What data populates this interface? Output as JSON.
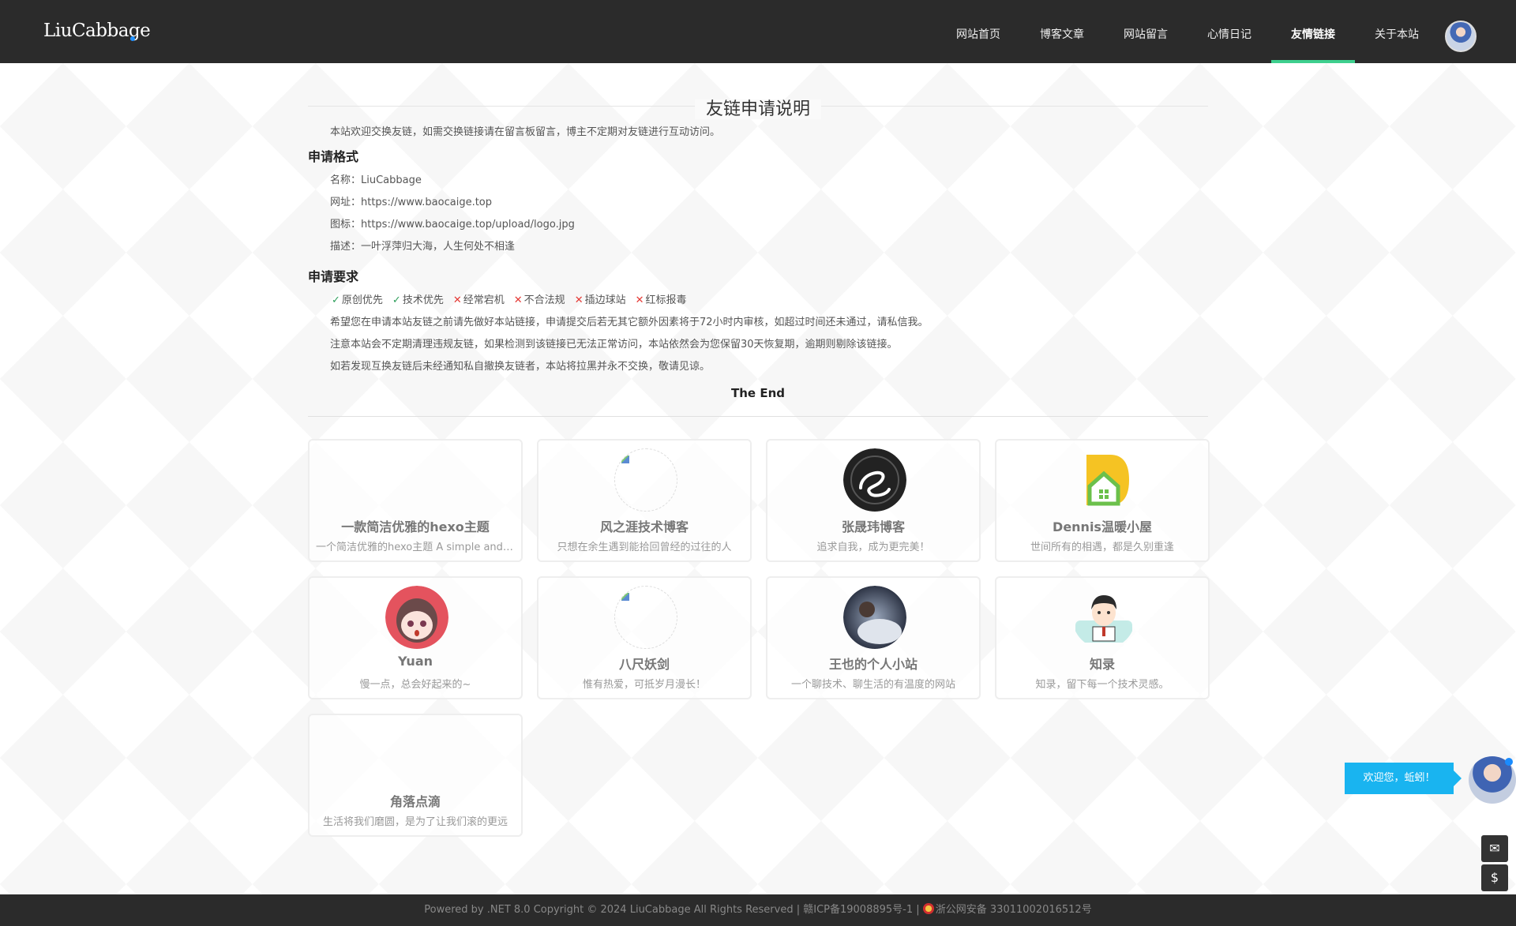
{
  "header": {
    "logo": "LiuCabbage",
    "nav": [
      {
        "label": "网站首页",
        "active": false
      },
      {
        "label": "博客文章",
        "active": false
      },
      {
        "label": "网站留言",
        "active": false
      },
      {
        "label": "心情日记",
        "active": false
      },
      {
        "label": "友情链接",
        "active": true
      },
      {
        "label": "关于本站",
        "active": false
      }
    ]
  },
  "main": {
    "title": "友链申请说明",
    "intro": "本站欢迎交换友链，如需交换链接请在留言板留言，博主不定期对友链进行互动访问。",
    "format_heading": "申请格式",
    "format_lines": [
      "名称：LiuCabbage",
      "网址：https://www.baocaige.top",
      "图标：https://www.baocaige.top/upload/logo.jpg",
      "描述：一叶浮萍归大海，人生何处不相逢"
    ],
    "req_heading": "申请要求",
    "requirements": [
      {
        "ok": true,
        "text": "原创优先"
      },
      {
        "ok": true,
        "text": "技术优先"
      },
      {
        "ok": false,
        "text": "经常宕机"
      },
      {
        "ok": false,
        "text": "不合法规"
      },
      {
        "ok": false,
        "text": "插边球站"
      },
      {
        "ok": false,
        "text": "红标报毒"
      }
    ],
    "notes": [
      "希望您在申请本站友链之前请先做好本站链接，申请提交后若无其它额外因素将于72小时内审核，如超过时间还未通过，请私信我。",
      "注意本站会不定期清理违规友链，如果检测到该链接已无法正常访问，本站依然会为您保留30天恢复期，逾期则剔除该链接。",
      "如若发现互换友链后未经通知私自撤换友链者，本站将拉黑并永不交换，敬请见谅。"
    ],
    "the_end": "The End"
  },
  "links": [
    {
      "name": "一款简洁优雅的hexo主题",
      "desc": "一个简洁优雅的hexo主题 A simple and elegant theme for hexo",
      "avatar": "empty"
    },
    {
      "name": "风之涯技术博客",
      "desc": "只想在余生遇到能拾回曾经的过往的人",
      "avatar": "broken"
    },
    {
      "name": "张晟玮博客",
      "desc": "追求自我，成为更完美！",
      "avatar": "swirl"
    },
    {
      "name": "Dennis温暖小屋",
      "desc": "世间所有的相遇，都是久别重逢",
      "avatar": "house"
    },
    {
      "name": "Yuan",
      "desc": "慢一点，总会好起来的~",
      "avatar": "girl"
    },
    {
      "name": "八尺妖剑",
      "desc": "惟有热爱，可抵岁月漫长！",
      "avatar": "broken"
    },
    {
      "name": "王也的个人小站",
      "desc": "一个聊技术、聊生活的有温度的网站",
      "avatar": "photo"
    },
    {
      "name": "知录",
      "desc": "知录，留下每一个技术灵感。",
      "avatar": "boy"
    },
    {
      "name": "角落点滴",
      "desc": "生活将我们磨圆，是为了让我们滚的更远",
      "avatar": "empty"
    }
  ],
  "footer": {
    "text_left": "Powered by .NET 8.0 Copyright © 2024 LiuCabbage All Rights Reserved | 赣ICP备19008895号-1 | ",
    "text_right": "浙公网安备 33011002016512号"
  },
  "widget": {
    "welcome": "欢迎您，蚯蚓！",
    "mail_icon": "mail-icon",
    "money_icon": "money-bag-icon"
  }
}
